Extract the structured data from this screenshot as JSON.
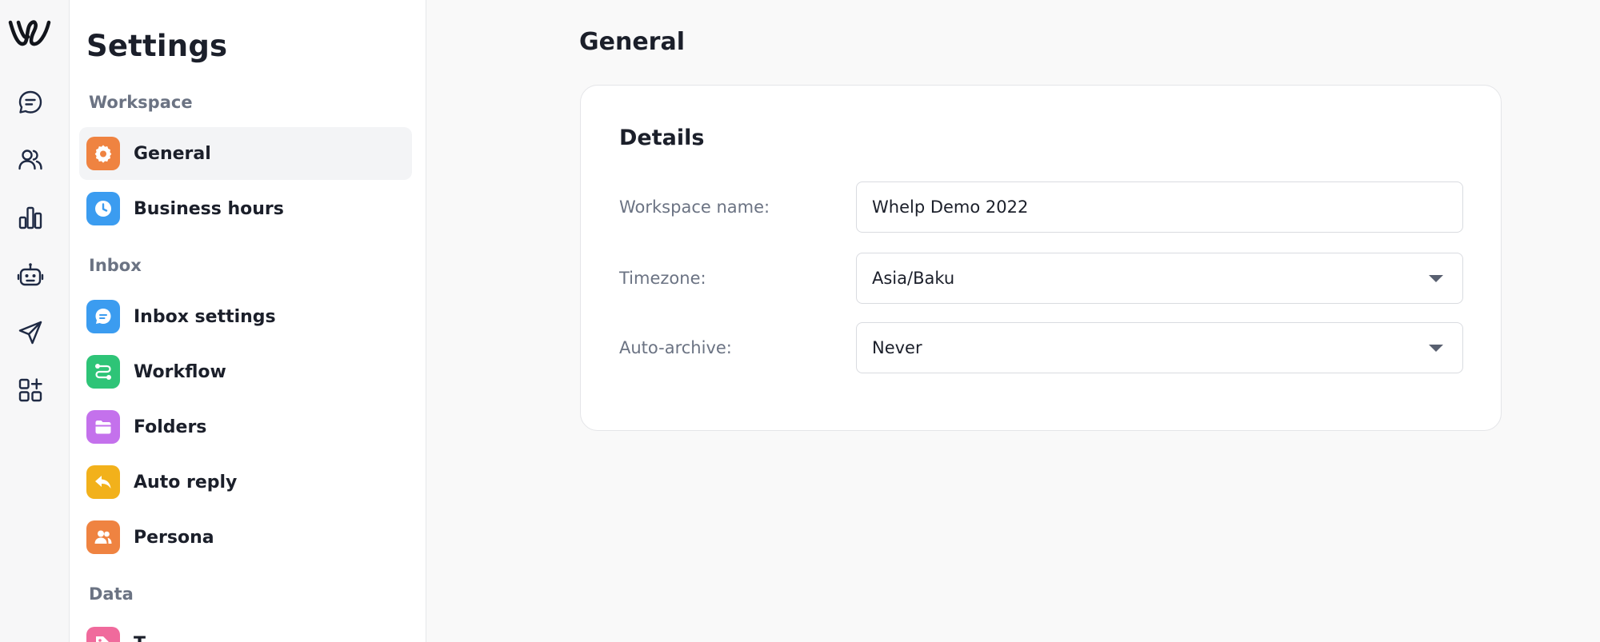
{
  "sidebar": {
    "title": "Settings",
    "sections": [
      {
        "label": "Workspace"
      },
      {
        "label": "Inbox"
      },
      {
        "label": "Data"
      }
    ],
    "items": [
      {
        "label": "General",
        "icon": "gear-icon",
        "color": "#ef8341",
        "active": true
      },
      {
        "label": "Business hours",
        "icon": "clock-icon",
        "color": "#3b9cf0"
      },
      {
        "label": "Inbox settings",
        "icon": "chat-icon",
        "color": "#3b9cf0"
      },
      {
        "label": "Workflow",
        "icon": "workflow-icon",
        "color": "#2ec477"
      },
      {
        "label": "Folders",
        "icon": "folder-icon",
        "color": "#c471ec"
      },
      {
        "label": "Auto reply",
        "icon": "reply-icon",
        "color": "#f2b11b"
      },
      {
        "label": "Persona",
        "icon": "persona-icon",
        "color": "#ef8341"
      },
      {
        "label": "T...",
        "icon": "tag-icon",
        "color": "#f06a9c"
      }
    ]
  },
  "rail": {
    "icons": [
      "logo-icon",
      "chat-icon",
      "users-icon",
      "chart-icon",
      "bot-icon",
      "send-icon",
      "apps-icon"
    ]
  },
  "main": {
    "title": "General",
    "card": {
      "title": "Details",
      "fields": [
        {
          "label": "Workspace name:",
          "value": "Whelp Demo 2022",
          "type": "text"
        },
        {
          "label": "Timezone:",
          "value": "Asia/Baku",
          "type": "select"
        },
        {
          "label": "Auto-archive:",
          "value": "Never",
          "type": "select"
        }
      ]
    }
  }
}
